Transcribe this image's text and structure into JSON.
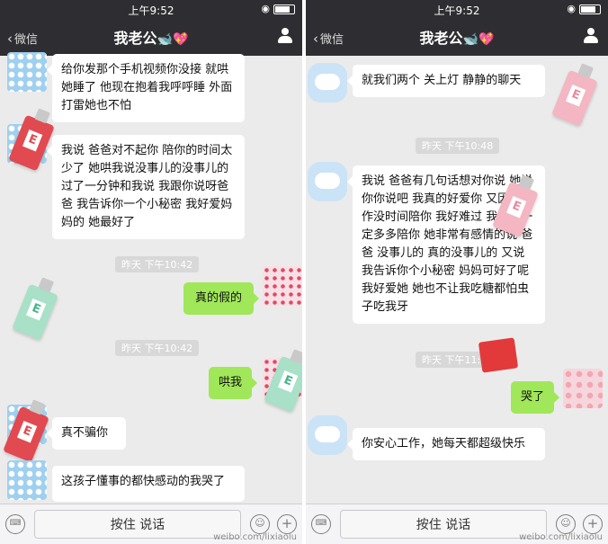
{
  "left": {
    "status_time": "上午9:52",
    "back_label": "微信",
    "chat_title": "我老公",
    "title_emoji": "🐋💖",
    "messages": [
      {
        "text": "给你发那个手机视频你没接 就哄她睡了 他现在抱着我呼呼睡 外面打雷她也不怕"
      },
      {
        "text": "我说 爸爸对不起你 陪你的时间太少了 她哄我说没事儿的没事儿的 过了一分钟和我说 我跟你说呀爸爸 我告诉你一个小秘密 我好爱妈妈的 她最好了"
      },
      {
        "timestamp": "昨天 下午10:42"
      },
      {
        "text": "真的假的"
      },
      {
        "timestamp": "昨天 下午10:42"
      },
      {
        "text": "哄我"
      },
      {
        "text": "真不骗你"
      },
      {
        "text": "这孩子懂事的都快感动的我哭了"
      }
    ],
    "input_label": "按住 说话",
    "watermark": "weibo.com/lixiaolu"
  },
  "right": {
    "status_time": "上午9:52",
    "back_label": "微信",
    "chat_title": "我老公",
    "title_emoji": "🐋💖",
    "messages": [
      {
        "text": "就我们两个 关上灯 静静的聊天"
      },
      {
        "timestamp": "昨天 下午10:48"
      },
      {
        "text": "我说 爸爸有几句话想对你说 她说你你说吧 我真的好爱你 又因为工作没时间陪你 我好难过 我今后一定多多陪你 她非常有感情的说 爸爸 没事儿的 真的没事儿的 又说 我告诉你个小秘密 妈妈可好了呢 我好爱她 她也不让我吃糖都怕虫子吃我牙"
      },
      {
        "timestamp": "昨天 下午11:09"
      },
      {
        "text": "哭了"
      },
      {
        "text": "你安心工作，她每天都超级快乐"
      }
    ],
    "input_label": "按住 说话",
    "watermark": "weibo.com/lixiaolu"
  }
}
